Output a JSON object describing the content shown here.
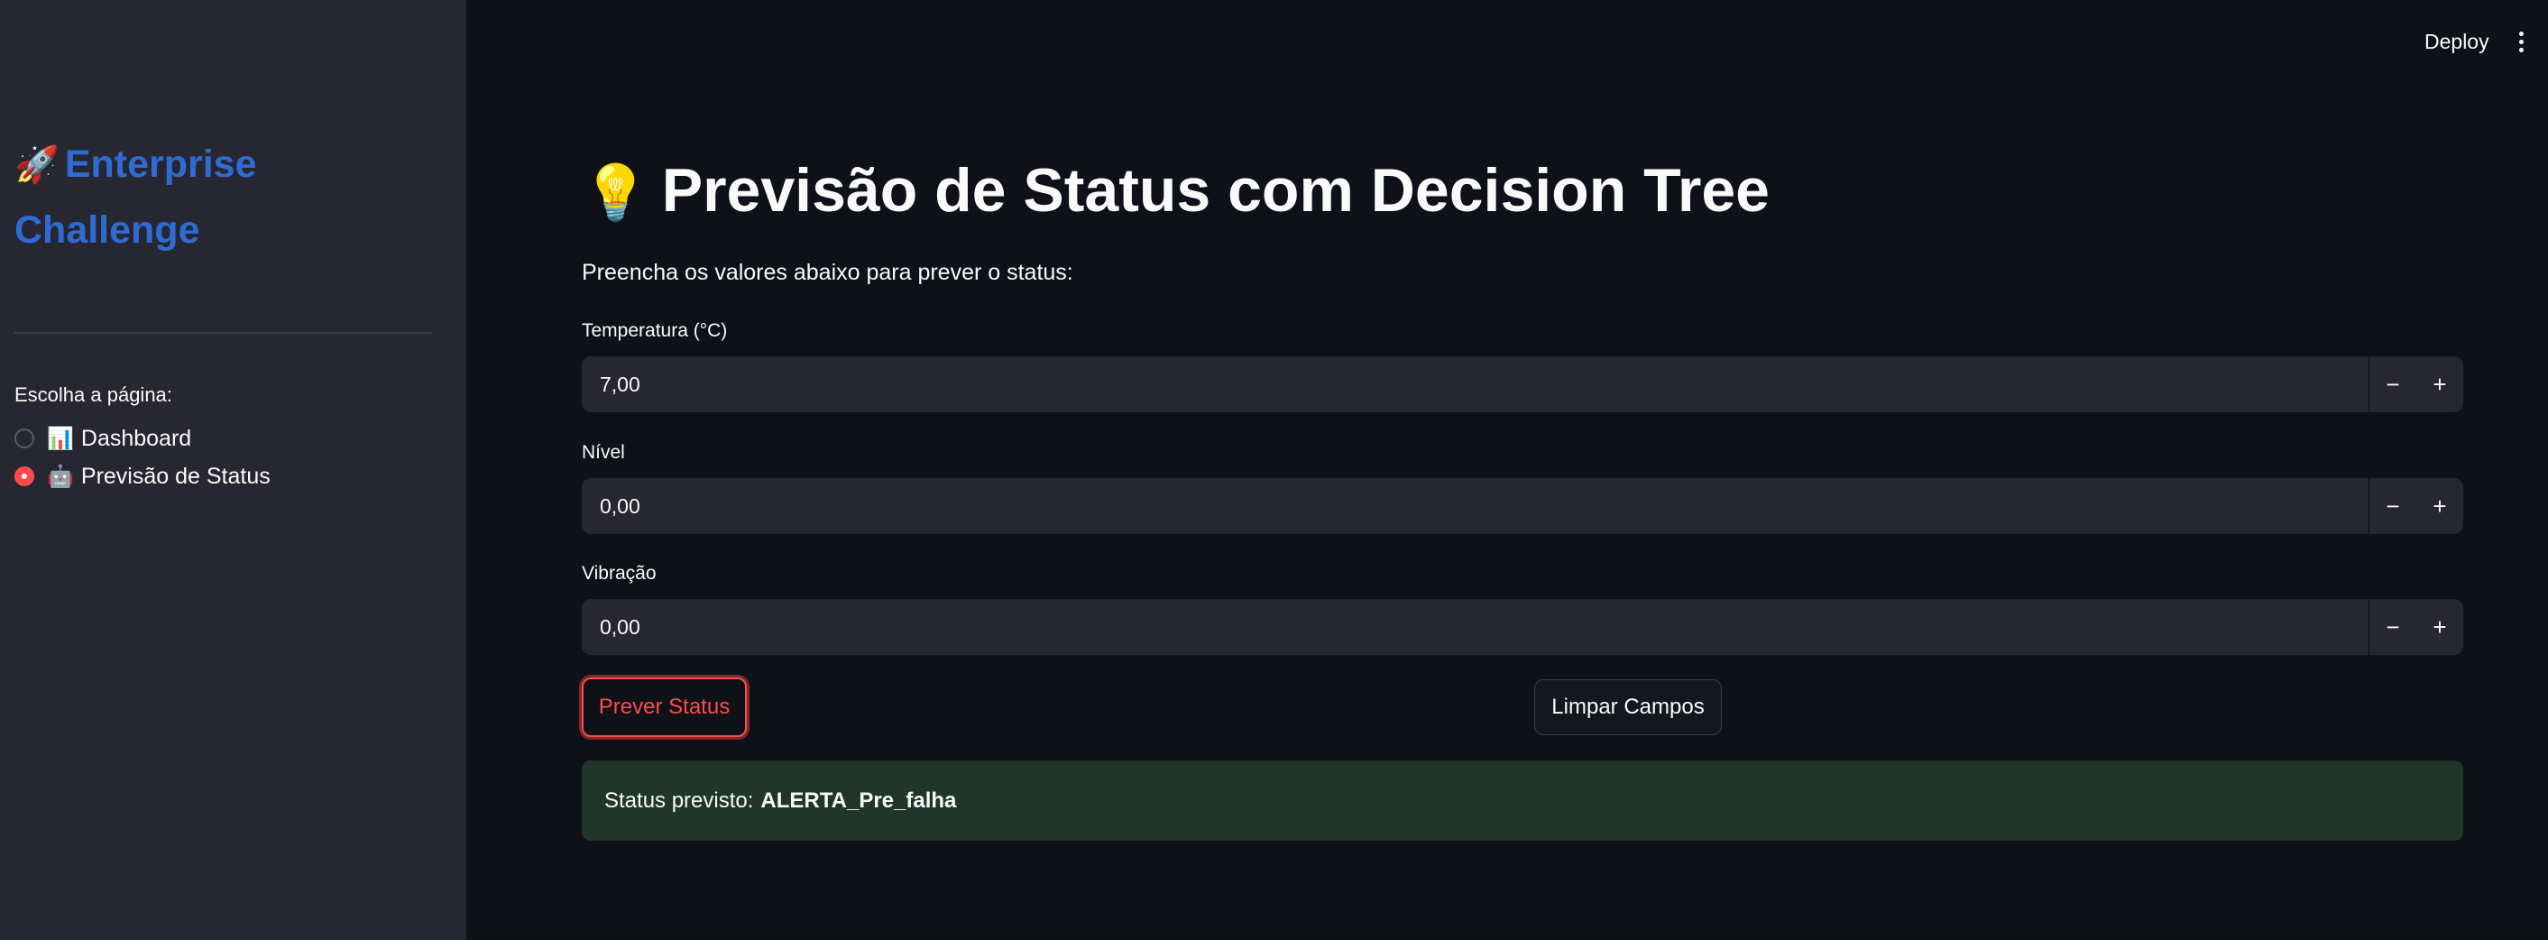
{
  "sidebar": {
    "title_icon": "🚀",
    "title": "Enterprise Challenge",
    "radio_label": "Escolha a página:",
    "options": [
      {
        "icon": "📊",
        "label": "Dashboard",
        "selected": false
      },
      {
        "icon": "🤖",
        "label": "Previsão de Status",
        "selected": true
      }
    ]
  },
  "header": {
    "deploy_label": "Deploy",
    "menu_icon": "more-vertical-icon"
  },
  "main": {
    "title_icon": "💡",
    "title": "Previsão de Status com Decision Tree",
    "subtitle": "Preencha os valores abaixo para prever o status:",
    "fields": [
      {
        "label": "Temperatura (°C)",
        "value": "7,00"
      },
      {
        "label": "Nível",
        "value": "0,00"
      },
      {
        "label": "Vibração",
        "value": "0,00"
      }
    ],
    "stepper": {
      "minus": "−",
      "plus": "+"
    },
    "predict_button": "Prever Status",
    "clear_button": "Limpar Campos",
    "result": {
      "prefix": "Status previsto:",
      "value": "ALERTA_Pre_falha"
    }
  },
  "colors": {
    "background": "#0e1117",
    "sidebar": "#262730",
    "accent": "#ff4b4b",
    "title_blue": "#2f6bd3",
    "success_bg": "#21362b"
  }
}
